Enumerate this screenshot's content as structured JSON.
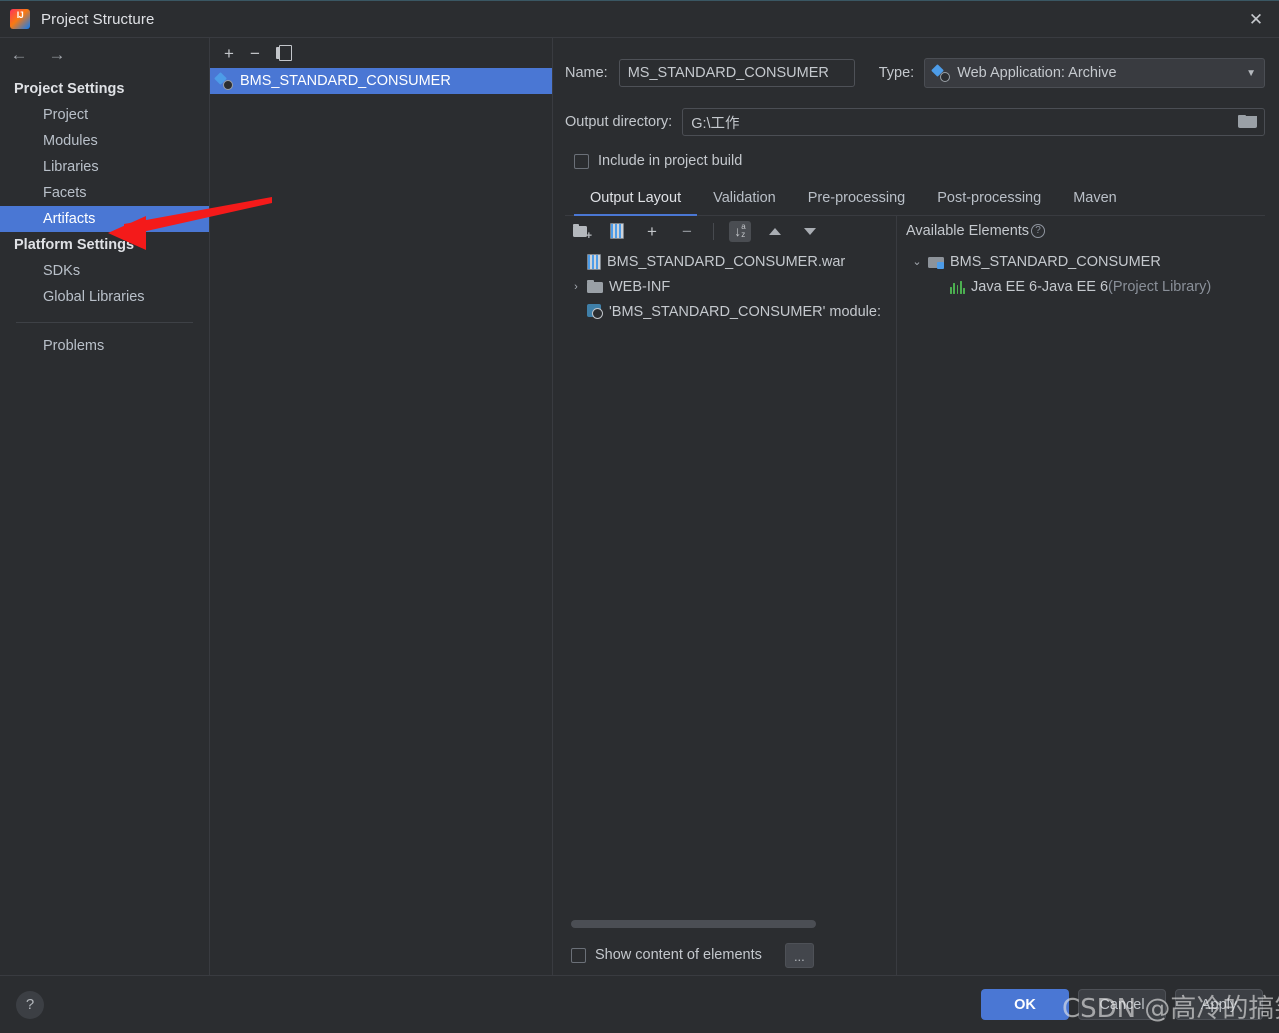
{
  "window": {
    "title": "Project Structure",
    "app_icon": "intellij-idea-icon",
    "close_label": "✕"
  },
  "sidebar": {
    "back_icon": "←",
    "forward_icon": "→",
    "groups": [
      {
        "label": "Project Settings",
        "items": [
          {
            "label": "Project",
            "selected": false
          },
          {
            "label": "Modules",
            "selected": false
          },
          {
            "label": "Libraries",
            "selected": false
          },
          {
            "label": "Facets",
            "selected": false
          },
          {
            "label": "Artifacts",
            "selected": true
          }
        ]
      },
      {
        "label": "Platform Settings",
        "items": [
          {
            "label": "SDKs",
            "selected": false
          },
          {
            "label": "Global Libraries",
            "selected": false
          }
        ]
      }
    ],
    "problems_label": "Problems"
  },
  "artifact_list": {
    "toolbar": {
      "add_label": "+",
      "remove_label": "−",
      "copy_icon": "copy-icon"
    },
    "items": [
      {
        "label": "BMS_STANDARD_CONSUMER",
        "selected": true,
        "icon": "artifact-icon"
      }
    ]
  },
  "details": {
    "name_label": "Name:",
    "name_value": "MS_STANDARD_CONSUMER",
    "type_label": "Type:",
    "type_value": "Web Application: Archive",
    "type_caret": "▼",
    "output_dir_label": "Output directory:",
    "output_dir_value": "G:\\工作",
    "include_in_build_label": "Include in project build",
    "include_in_build_checked": false,
    "tabs": [
      {
        "label": "Output Layout",
        "active": true
      },
      {
        "label": "Validation",
        "active": false
      },
      {
        "label": "Pre-processing",
        "active": false
      },
      {
        "label": "Post-processing",
        "active": false
      },
      {
        "label": "Maven",
        "active": false
      }
    ],
    "tree_toolbar": {
      "new_folder": "create-directory-icon",
      "new_archive": "create-archive-icon",
      "add": "+",
      "remove": "−",
      "sort": "sort-alphabetically-icon",
      "move_up": "move-up-icon",
      "move_down": "move-down-icon"
    },
    "output_tree": [
      {
        "label": "BMS_STANDARD_CONSUMER.war",
        "icon": "war-archive-icon",
        "indent": 0,
        "chevron": ""
      },
      {
        "label": "WEB-INF",
        "icon": "folder-icon",
        "indent": 1,
        "chevron": "›"
      },
      {
        "label": "'BMS_STANDARD_CONSUMER' module:",
        "icon": "module-output-icon",
        "indent": 1,
        "chevron": ""
      }
    ],
    "show_content_label": "Show content of elements",
    "show_content_checked": false,
    "dots_button_label": "...",
    "available_elements": {
      "title": "Available Elements",
      "help_icon": "?",
      "tree": [
        {
          "label": "BMS_STANDARD_CONSUMER",
          "suffix": "",
          "icon": "folder-module-icon",
          "indent": 0,
          "chevron": "⌄"
        },
        {
          "label": "Java EE 6-Java EE 6",
          "suffix": " (Project Library)",
          "icon": "library-icon",
          "indent": 1,
          "chevron": ""
        }
      ]
    }
  },
  "footer": {
    "help_label": "?",
    "buttons": [
      {
        "label": "OK",
        "style": "primary"
      },
      {
        "label": "Cancel",
        "style": "normal"
      },
      {
        "label": "Apply",
        "style": "normal"
      }
    ]
  },
  "annotations": {
    "watermark": "CSDN @高冷的搞笑员",
    "arrow_color": "#f41a1a"
  }
}
